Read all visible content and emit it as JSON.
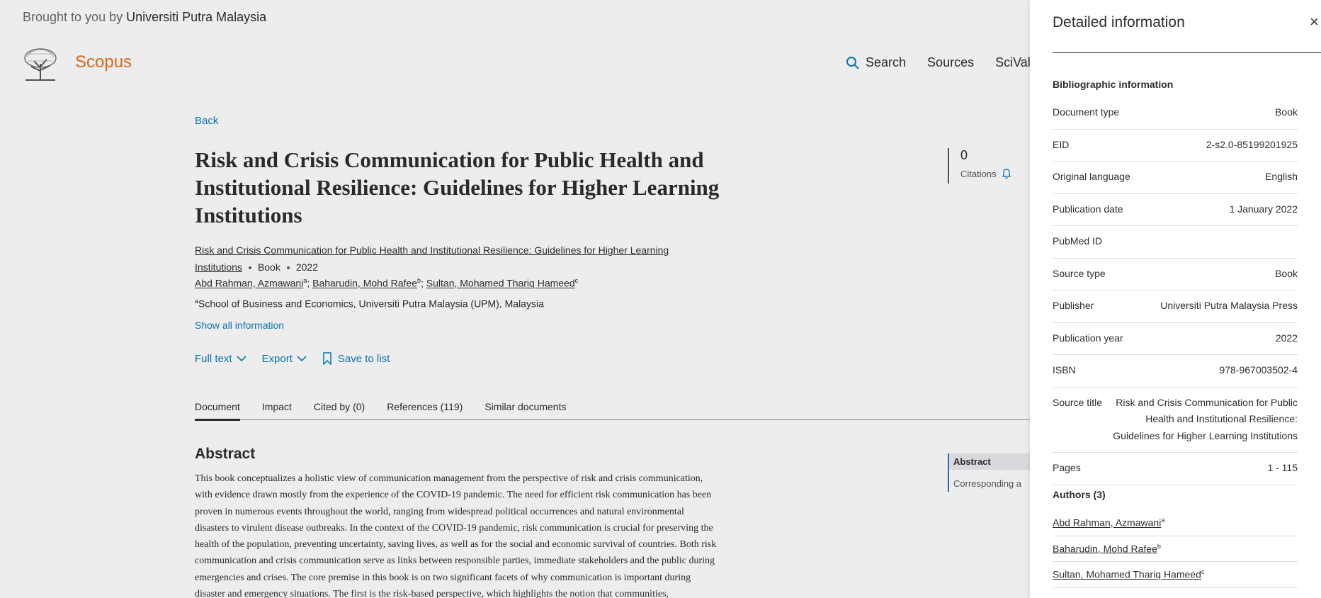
{
  "header": {
    "brought_prefix": "Brought to you by",
    "institution": "Universiti Putra Malaysia",
    "brand": "Scopus",
    "nav": [
      {
        "label": "Search",
        "icon": "search-icon"
      },
      {
        "label": "Sources"
      },
      {
        "label": "SciVal"
      }
    ]
  },
  "document": {
    "back": "Back",
    "title": "Risk and Crisis Communication for Public Health and Institutional Resilience: Guidelines for Higher Learning Institutions",
    "source_title": "Risk and Crisis Communication for Public Health and Institutional Resilience: Guidelines for Higher Learning Institutions",
    "doc_type": "Book",
    "year": "2022",
    "authors": [
      {
        "name": "Abd Rahman, Azmawani",
        "sup": "a"
      },
      {
        "name": "Baharudin, Mohd Rafee",
        "sup": "b"
      },
      {
        "name": "Sultan, Mohamed Thariq Hameed",
        "sup": "c"
      }
    ],
    "affiliation": {
      "sup": "a",
      "text": "School of Business and Economics, Universiti Putra Malaysia (UPM), Malaysia"
    },
    "show_all": "Show all information",
    "actions": {
      "full_text": "Full text",
      "export": "Export",
      "save": "Save to list"
    },
    "tabs": [
      "Document",
      "Impact",
      "Cited by (0)",
      "References (119)",
      "Similar documents"
    ],
    "abstract_heading": "Abstract",
    "abstract_lines": [
      "This book conceptualizes a holistic view of communication management from the perspective of risk and crisis communication,",
      "with evidence drawn mostly from the experience of the COVID-19 pandemic. The need for efficient risk communication has been",
      "proven in numerous events throughout the world, ranging from widespread political occurrences and natural environmental",
      "disasters to virulent disease outbreaks. In the context of the COVID-19 pandemic, risk communication is crucial for preserving the",
      "health of the population, preventing uncertainty, saving lives, as well as for the social and economic survival of countries. Both risk",
      "communication and crisis communication serve as links between responsible parties, immediate stakeholders and the public during",
      "emergencies and crises. The core premise in this book is on two significant facets of why communication is important during",
      "disaster and emergency situations. The first is the risk-based perspective, which highlights the notion that communities,"
    ],
    "citations_count": "0",
    "citations_label": "Citations",
    "toc": [
      "Abstract",
      "Corresponding a"
    ]
  },
  "panel": {
    "title": "Detailed information",
    "close": "×",
    "biblio_heading": "Bibliographic information",
    "rows": [
      {
        "k": "Document type",
        "v": "Book"
      },
      {
        "k": "EID",
        "v": "2-s2.0-85199201925"
      },
      {
        "k": "Original language",
        "v": "English"
      },
      {
        "k": "Publication date",
        "v": "1 January 2022"
      },
      {
        "k": "PubMed ID",
        "v": ""
      },
      {
        "k": "Source type",
        "v": "Book"
      },
      {
        "k": "Publisher",
        "v": "Universiti Putra Malaysia Press"
      },
      {
        "k": "Publication year",
        "v": "2022"
      },
      {
        "k": "ISBN",
        "v": "978-967003502-4"
      },
      {
        "k": "Source title",
        "v": "Risk and Crisis Communication for Public Health and Institutional Resilience: Guidelines for Higher Learning Institutions"
      },
      {
        "k": "Pages",
        "v": "1 - 115"
      }
    ],
    "authors_heading": "Authors (3)",
    "authors": [
      {
        "name": "Abd Rahman, Azmawani",
        "sup": "a"
      },
      {
        "name": "Baharudin, Mohd Rafee",
        "sup": "b"
      },
      {
        "name": "Sultan, Mohamed Thariq Hameed",
        "sup": "c"
      }
    ]
  },
  "colors": {
    "brand": "#e9711c",
    "link": "#0c7dbb",
    "text": "#2e2e2e"
  }
}
